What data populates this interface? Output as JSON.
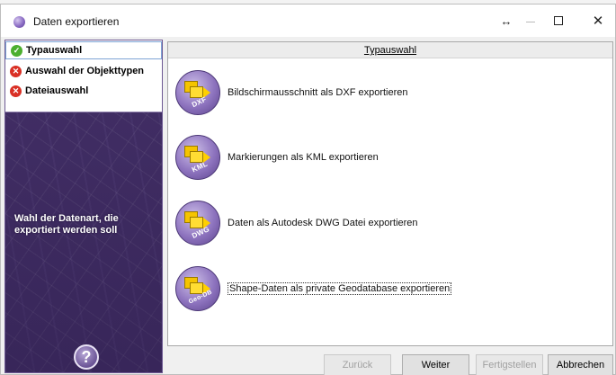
{
  "window": {
    "title": "Daten exportieren"
  },
  "titlebar": {
    "resize_glyph": "↔",
    "minimize_icon": "minimize-icon",
    "maximize_icon": "maximize-icon",
    "close_glyph": "✕"
  },
  "steps": [
    {
      "label": "Typauswahl",
      "status": "done"
    },
    {
      "label": "Auswahl der Objekttypen",
      "status": "error"
    },
    {
      "label": "Dateiauswahl",
      "status": "error"
    }
  ],
  "left_panel": {
    "description": "Wahl der Datenart, die exportiert werden soll",
    "help_glyph": "?"
  },
  "main": {
    "header": "Typauswahl",
    "options": [
      {
        "badge": "DXF",
        "label": "Bildschirmausschnitt als DXF exportieren"
      },
      {
        "badge": "KML",
        "label": "Markierungen als KML exportieren"
      },
      {
        "badge": "DWG",
        "label": "Daten als Autodesk DWG Datei exportieren"
      },
      {
        "badge": "Geo-DB",
        "label": "Shape-Daten als private Geodatabase exportieren"
      }
    ]
  },
  "buttons": {
    "back": "Zurück",
    "next": "Weiter",
    "finish": "Fertigstellen",
    "cancel": "Abbrechen"
  },
  "colors": {
    "success": "#4caf30",
    "error": "#d93025",
    "accent": "#5c438d"
  }
}
